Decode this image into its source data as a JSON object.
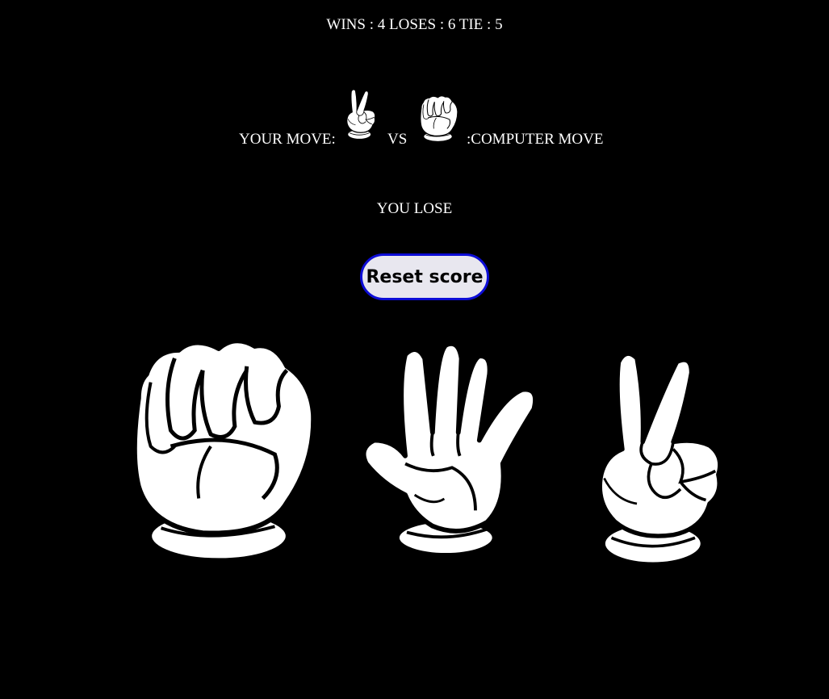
{
  "score": {
    "text": "WINS : 4 LOSES : 6 TIE : 5",
    "wins": 4,
    "loses": 6,
    "tie": 5
  },
  "moves": {
    "your_label": "YOUR MOVE:",
    "vs_label": "VS",
    "computer_label": ":COMPUTER MOVE",
    "your_move": "scissors",
    "computer_move": "rock"
  },
  "result_text": "YOU LOSE",
  "reset_label": "Reset score",
  "choices": [
    {
      "name": "rock",
      "icon": "rock-hand-icon"
    },
    {
      "name": "paper",
      "icon": "paper-hand-icon"
    },
    {
      "name": "scissors",
      "icon": "scissors-hand-icon"
    }
  ],
  "colors": {
    "background": "#000000",
    "text": "#ffffff",
    "button_bg": "#e8e7ef",
    "button_border": "#0d0dd6"
  }
}
